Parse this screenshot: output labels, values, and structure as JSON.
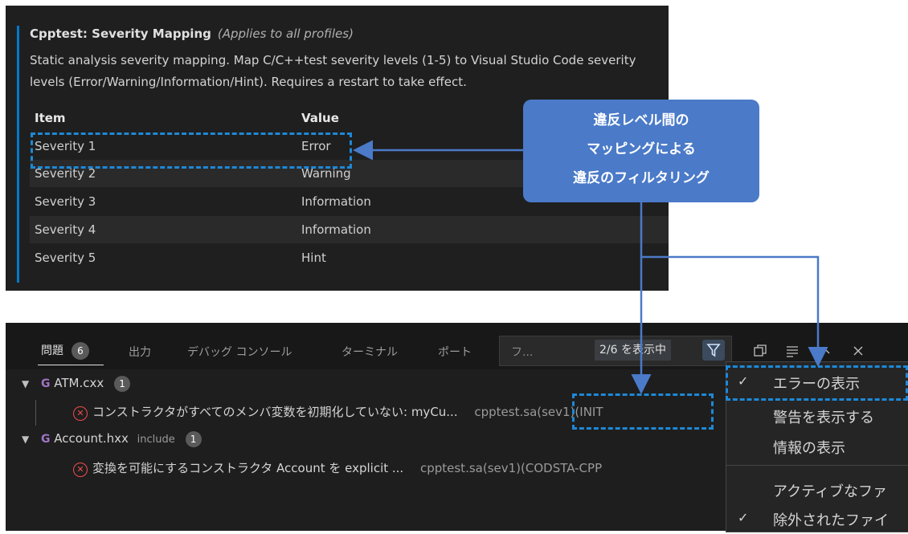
{
  "settings": {
    "title": "Cpptest: Severity Mapping",
    "scope": "(Applies to all profiles)",
    "description": "Static analysis severity mapping. Map C/C++test severity levels (1-5) to Visual Studio Code severity levels (Error/Warning/Information/Hint). Requires a restart to take effect.",
    "col_item": "Item",
    "col_value": "Value",
    "rows": [
      {
        "item": "Severity 1",
        "value": "Error"
      },
      {
        "item": "Severity 2",
        "value": "Warning"
      },
      {
        "item": "Severity 3",
        "value": "Information"
      },
      {
        "item": "Severity 4",
        "value": "Information"
      },
      {
        "item": "Severity 5",
        "value": "Hint"
      }
    ]
  },
  "callout": {
    "line1": "違反レベル間の",
    "line2": "マッピングによる",
    "line3": "違反のフィルタリング"
  },
  "panel": {
    "tabs": [
      {
        "label": "問題",
        "badge": "6"
      },
      {
        "label": "出力"
      },
      {
        "label": "デバッグ コンソール"
      },
      {
        "label": "ターミナル"
      },
      {
        "label": "ポート"
      }
    ],
    "filter_placeholder": "フ...",
    "filter_count": "2/6 を表示中"
  },
  "problems": [
    {
      "file": "ATM.cxx",
      "suffix": "",
      "count": "1",
      "message": "コンストラクタがすべてのメンバ変数を初期化していない: myCu...",
      "source": "cpptest.sa(sev1)(INIT"
    },
    {
      "file": "Account.hxx",
      "suffix": "include",
      "count": "1",
      "message": "変換を可能にするコンストラクタ Account を explicit ...",
      "source": "cpptest.sa(sev1)(CODSTA-CPP"
    }
  ],
  "menu": {
    "items": [
      {
        "label": "エラーの表示",
        "checked": true
      },
      {
        "label": "警告を表示する",
        "checked": false
      },
      {
        "label": "情報の表示",
        "checked": false
      },
      {
        "label": "アクティブなファ",
        "checked": false
      },
      {
        "label": "除外されたファイ",
        "checked": true
      }
    ],
    "check_glyph": "✓"
  },
  "colors": {
    "accent": "#1e88d6",
    "callout": "#4a7ac8",
    "error": "#f14c4c"
  }
}
